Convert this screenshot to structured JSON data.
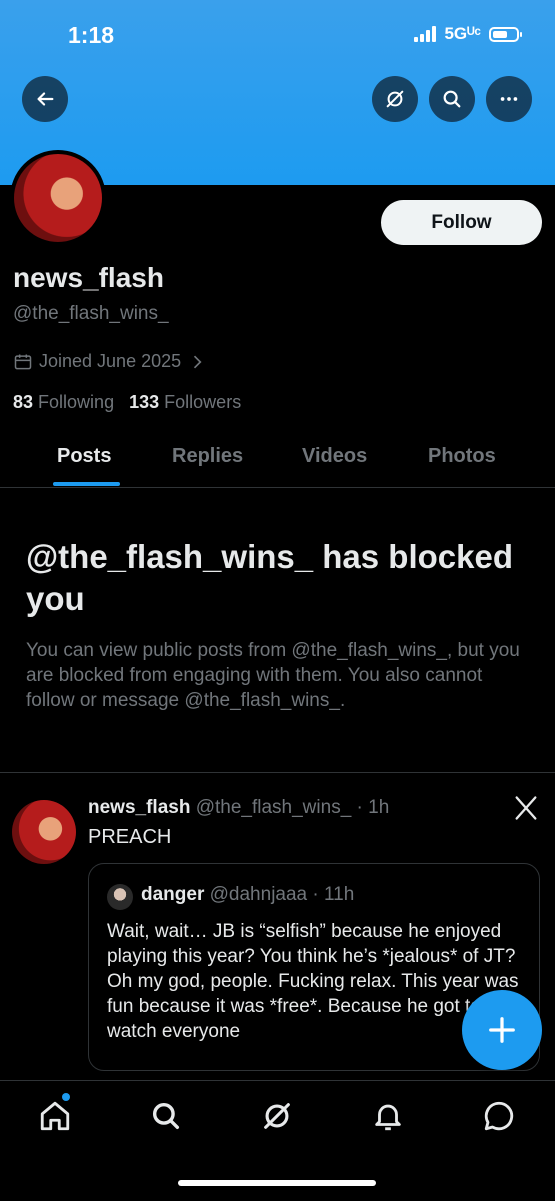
{
  "status_bar": {
    "time": "1:18",
    "network": "5Gᵁᶜ"
  },
  "header_actions": [
    "back-icon",
    "grok-icon",
    "search-icon",
    "more-icon"
  ],
  "profile": {
    "display_name": "news_flash",
    "handle": "@the_flash_wins_",
    "joined": "Joined June 2025",
    "following_count": "83",
    "following_label": "Following",
    "followers_count": "133",
    "followers_label": "Followers",
    "follow_button": "Follow"
  },
  "tabs": [
    {
      "label": "Posts",
      "active": true
    },
    {
      "label": "Replies",
      "active": false
    },
    {
      "label": "Videos",
      "active": false
    },
    {
      "label": "Photos",
      "active": false
    }
  ],
  "blocked": {
    "title": "@the_flash_wins_ has blocked you",
    "body": "You can view public posts from @the_flash_wins_, but you are blocked from engaging with them. You also cannot follow or message @the_flash_wins_."
  },
  "post": {
    "name": "news_flash",
    "meta": "@the_flash_wins_ · 1h",
    "text": "PREACH",
    "quote": {
      "name": "danger",
      "meta": "@dahnjaaa · 11h",
      "text": "Wait, wait… JB is “selfish” because he enjoyed playing this year? You think he’s *jealous* of JT? Oh my god, people. Fucking relax. This year was fun because it was *free*. Because he got to watch everyone"
    }
  },
  "bottom_nav": [
    "home-icon",
    "search-icon",
    "grok-icon",
    "notifications-icon",
    "messages-icon"
  ],
  "colors": {
    "accent": "#1d9bf0",
    "background": "#000000",
    "muted_text": "#71767b"
  }
}
